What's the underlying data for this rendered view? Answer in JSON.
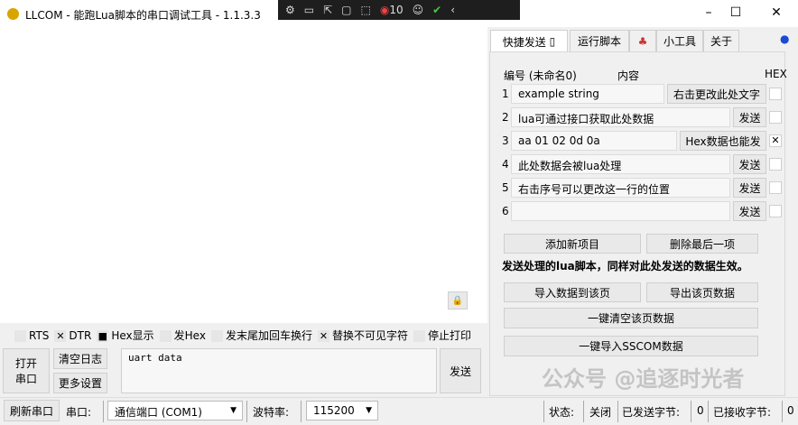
{
  "window": {
    "title": "LLCOM - 能跑Lua脚本的串口调试工具 - 1.1.3.3",
    "minimize": "–",
    "maximize": "☐",
    "close": "✕"
  },
  "overlay": {
    "count": "10"
  },
  "tabs": [
    {
      "label": "快捷发送"
    },
    {
      "label": "运行脚本"
    },
    {
      "label": ""
    },
    {
      "label": "小工具"
    },
    {
      "label": "关于"
    }
  ],
  "quick_send": {
    "header_index": "编号 (未命名0)",
    "header_content": "内容",
    "header_hex": "HEX",
    "rows": [
      {
        "num": "1",
        "value": "example string",
        "button": "右击更改此处文字",
        "hex": ""
      },
      {
        "num": "2",
        "value": "lua可通过接口获取此处数据",
        "button": "发送",
        "hex": ""
      },
      {
        "num": "3",
        "value": "aa 01 02 0d 0a",
        "button": "Hex数据也能发",
        "hex": "✕"
      },
      {
        "num": "4",
        "value": "此处数据会被lua处理",
        "button": "发送",
        "hex": ""
      },
      {
        "num": "5",
        "value": "右击序号可以更改这一行的位置",
        "button": "发送",
        "hex": ""
      },
      {
        "num": "6",
        "value": "",
        "button": "发送",
        "hex": ""
      }
    ],
    "add": "添加新项目",
    "delete_last": "删除最后一项",
    "note": "发送处理的lua脚本，同样对此处发送的数据生效。",
    "import_page": "导入数据到该页",
    "export_page": "导出该页数据",
    "clear_page": "一键清空该页数据",
    "import_sscom": "一键导入SSCOM数据"
  },
  "options": [
    {
      "label": "RTS",
      "mark": ""
    },
    {
      "label": "DTR",
      "mark": "✕"
    },
    {
      "label": "Hex显示",
      "mark": "■"
    },
    {
      "label": "发Hex",
      "mark": ""
    },
    {
      "label": "发末尾加回车换行",
      "mark": ""
    },
    {
      "label": "替换不可见字符",
      "mark": "✕"
    },
    {
      "label": "停止打印",
      "mark": ""
    }
  ],
  "controls": {
    "open_port": "打开\n串口",
    "clear_log": "清空日志",
    "more_settings": "更多设置",
    "send_text": "uart data",
    "send": "发送"
  },
  "statusbar": {
    "refresh": "刷新串口",
    "port_label": "串口:",
    "port": "通信端口 (COM1)",
    "baud_label": "波特率:",
    "baud": "115200",
    "state_label": "状态:",
    "state": "关闭",
    "sent_label": "已发送字节:",
    "sent": "0",
    "recv_label": "已接收字节:",
    "recv": "0"
  },
  "watermark": "公众号 @追逐时光者"
}
